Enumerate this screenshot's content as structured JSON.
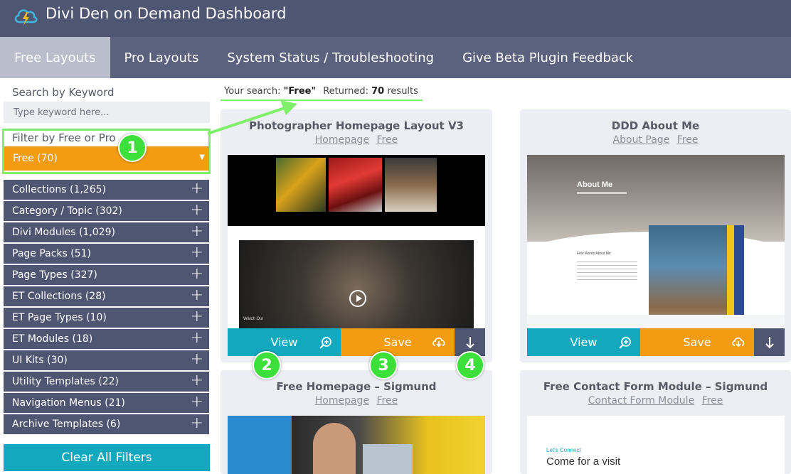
{
  "header": {
    "title": "Divi Den on Demand Dashboard",
    "colors": {
      "bar": "#4f5672",
      "tabs": "#5b627e",
      "active_tab": "#b9bdcc"
    }
  },
  "tabs": [
    {
      "label": "Free Layouts",
      "active": true
    },
    {
      "label": "Pro Layouts",
      "active": false
    },
    {
      "label": "System Status / Troubleshooting",
      "active": false
    },
    {
      "label": "Give Beta Plugin Feedback",
      "active": false
    }
  ],
  "sidebar": {
    "search_label": "Search by Keyword",
    "search_placeholder": "Type keyword here...",
    "filter_label": "Filter by Free or Pro",
    "filter_value": "Free  (70)",
    "filters": [
      {
        "label": "Collections (1,265)"
      },
      {
        "label": "Category / Topic (302)"
      },
      {
        "label": "Divi Modules (1,029)"
      },
      {
        "label": "Page Packs (51)"
      },
      {
        "label": "Page Types (327)"
      },
      {
        "label": "ET Collections (28)"
      },
      {
        "label": "ET Page Types (10)"
      },
      {
        "label": "ET Modules (18)"
      },
      {
        "label": "UI Kits (30)"
      },
      {
        "label": "Utility Templates (22)"
      },
      {
        "label": "Navigation Menus (21)"
      },
      {
        "label": "Archive Templates (6)"
      }
    ],
    "clear_label": "Clear All Filters"
  },
  "summary": {
    "prefix": "Your search: ",
    "query": "\"Free\"",
    "returned_label": "Returned: ",
    "count": "70",
    "suffix": " results"
  },
  "cards": [
    {
      "title": "Photographer Homepage Layout V3",
      "tags": [
        "Homepage",
        "Free"
      ],
      "view_label": "View",
      "save_label": "Save"
    },
    {
      "title": "DDD About Me",
      "tags": [
        "About Page",
        "Free"
      ],
      "view_label": "View",
      "save_label": "Save",
      "preview_heading": "About Me",
      "preview_subheading": "Few Words About Me"
    },
    {
      "title": "Free Homepage – Sigmund",
      "tags": [
        "Homepage",
        "Free"
      ]
    },
    {
      "title": "Free Contact Form Module – Sigmund",
      "tags": [
        "Contact Form Module",
        "Free"
      ],
      "preview_kicker": "Let's Connect",
      "preview_heading": "Come for a visit"
    }
  ],
  "badges": [
    "1",
    "2",
    "3",
    "4"
  ],
  "photo_caption": "Watch Our"
}
